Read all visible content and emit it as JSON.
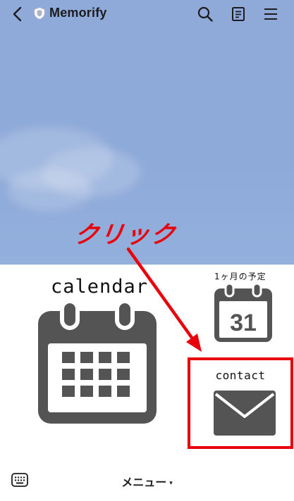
{
  "header": {
    "title": "Memorify",
    "back_icon": "chevron-left-icon",
    "verified_icon": "shield-icon",
    "actions": [
      "search-icon",
      "note-icon",
      "hamburger-menu-icon"
    ]
  },
  "rich_menu": {
    "calendar": {
      "label": "calendar",
      "icon": "calendar-icon"
    },
    "monthly_plan": {
      "label": "1ヶ月の予定",
      "day": "31",
      "icon": "calendar-31-icon"
    },
    "contact": {
      "label": "contact",
      "icon": "envelope-icon"
    }
  },
  "annotation": {
    "text": "クリック",
    "color": "#e8000b"
  },
  "bottom_bar": {
    "keyboard_icon": "keyboard-icon",
    "menu_label": "メニュー",
    "menu_caret": "▾"
  },
  "colors": {
    "chat_background": "#8fa9d8",
    "icon_gray": "#545454",
    "highlight_red": "#e8000b"
  }
}
